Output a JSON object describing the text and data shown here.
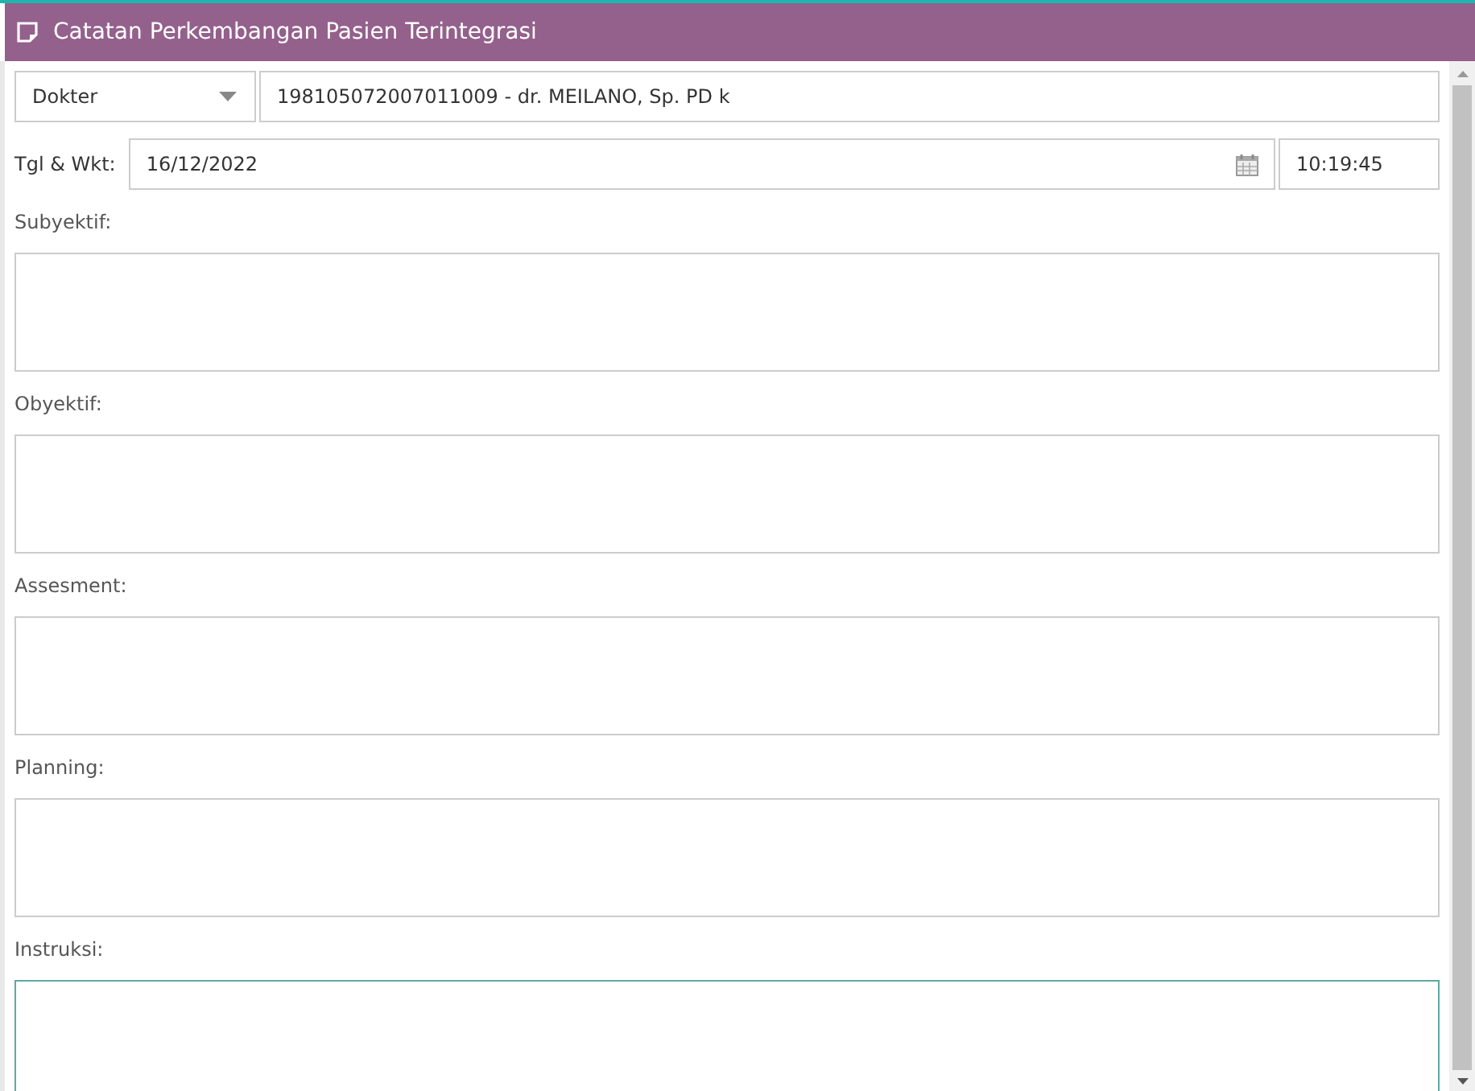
{
  "window": {
    "title": "Catatan Perkembangan Pasien Terintegrasi"
  },
  "role_select": {
    "value": "Dokter"
  },
  "doctor_field": {
    "value": "198105072007011009 - dr. MEILANO, Sp. PD k"
  },
  "datetime": {
    "label": "Tgl & Wkt:",
    "date": "16/12/2022",
    "time": "10:19:45"
  },
  "sections": [
    {
      "label": "Subyektif:",
      "focused": false
    },
    {
      "label": "Obyektif:",
      "focused": false
    },
    {
      "label": "Assesment:",
      "focused": false
    },
    {
      "label": "Planning:",
      "focused": false
    },
    {
      "label": "Instruksi:",
      "focused": true
    }
  ]
}
